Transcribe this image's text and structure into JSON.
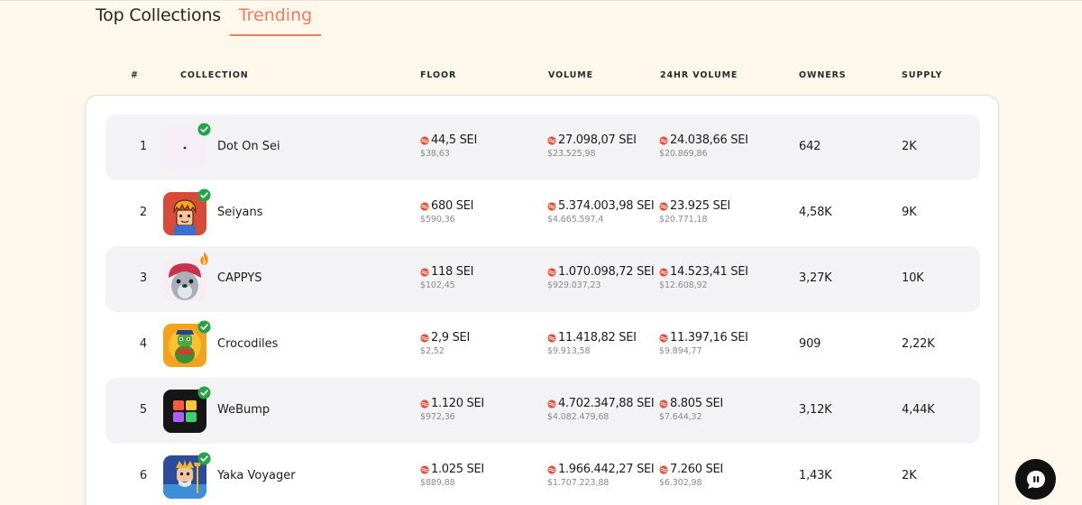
{
  "tabs": {
    "top": "Top Collections",
    "trending": "Trending"
  },
  "columns": {
    "rank": "#",
    "collection": "COLLECTION",
    "floor": "FLOOR",
    "volume": "VOLUME",
    "volume_24h": "24HR VOLUME",
    "owners": "OWNERS",
    "supply": "SUPPLY"
  },
  "rows": [
    {
      "rank": "1",
      "name": "Dot On Sei",
      "badge_icon": "verified-check-icon",
      "floor": "44,5 SEI",
      "floor_usd": "$38,63",
      "volume": "27.098,07 SEI",
      "volume_usd": "$23.525,98",
      "volume_24h": "24.038,66 SEI",
      "volume_24h_usd": "$20.869,86",
      "owners": "642",
      "supply": "2K"
    },
    {
      "rank": "2",
      "name": "Seiyans",
      "badge_icon": "verified-check-icon",
      "floor": "680 SEI",
      "floor_usd": "$590,36",
      "volume": "5.374.003,98 SEI",
      "volume_usd": "$4.665.597,4",
      "volume_24h": "23.925 SEI",
      "volume_24h_usd": "$20.771,18",
      "owners": "4,58K",
      "supply": "9K"
    },
    {
      "rank": "3",
      "name": "CAPPYS",
      "badge_icon": "flame-icon",
      "floor": "118 SEI",
      "floor_usd": "$102,45",
      "volume": "1.070.098,72 SEI",
      "volume_usd": "$929.037,23",
      "volume_24h": "14.523,41 SEI",
      "volume_24h_usd": "$12.608,92",
      "owners": "3,27K",
      "supply": "10K"
    },
    {
      "rank": "4",
      "name": "Crocodiles",
      "badge_icon": "verified-check-icon",
      "floor": "2,9 SEI",
      "floor_usd": "$2,52",
      "volume": "11.418,82 SEI",
      "volume_usd": "$9.913,58",
      "volume_24h": "11.397,16 SEI",
      "volume_24h_usd": "$9.894,77",
      "owners": "909",
      "supply": "2,22K"
    },
    {
      "rank": "5",
      "name": "WeBump",
      "badge_icon": "verified-check-icon",
      "floor": "1.120 SEI",
      "floor_usd": "$972,36",
      "volume": "4.702.347,88 SEI",
      "volume_usd": "$4.082.479,68",
      "volume_24h": "8.805 SEI",
      "volume_24h_usd": "$7.644,32",
      "owners": "3,12K",
      "supply": "4,44K"
    },
    {
      "rank": "6",
      "name": "Yaka Voyager",
      "badge_icon": "verified-check-icon",
      "floor": "1.025 SEI",
      "floor_usd": "$889,88",
      "volume": "1.966.442,27 SEI",
      "volume_usd": "$1.707.223,88",
      "volume_24h": "7.260 SEI",
      "volume_24h_usd": "$6.302,98",
      "owners": "1,43K",
      "supply": "2K"
    }
  ],
  "colors": {
    "accent": "#ef7d5e",
    "page_bg": "#fdf7ec",
    "row_shade": "#f3f3f5",
    "verified": "#22a447",
    "sei_icon": "#e0533b"
  },
  "icons": {
    "currency": "sei-icon",
    "chat": "chat-bubble-icon"
  }
}
